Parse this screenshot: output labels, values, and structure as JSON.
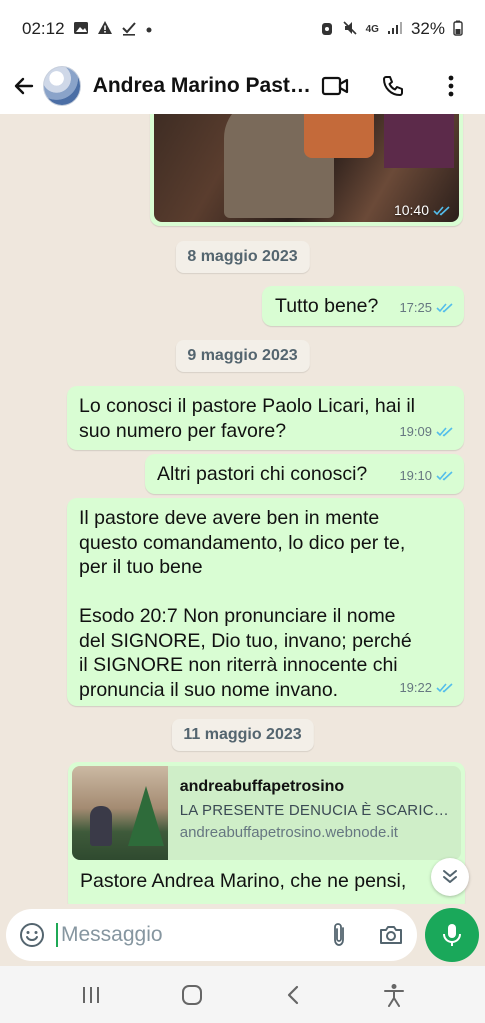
{
  "status_bar": {
    "time": "02:12",
    "battery": "32%",
    "network": "4G"
  },
  "header": {
    "contact_name": "Andrea Marino Pastore..."
  },
  "messages": {
    "photo": {
      "time": "10:40"
    },
    "date1": "8 maggio 2023",
    "m1": {
      "text": "Tutto bene?",
      "time": "17:25"
    },
    "date2": "9 maggio 2023",
    "m2": {
      "line1": "Lo conosci il pastore Paolo Licari, hai il",
      "line2": "suo numero per favore?",
      "time": "19:09"
    },
    "m3": {
      "text": "Altri pastori chi conosci?",
      "time": "19:10"
    },
    "m4": {
      "lines": [
        "Il pastore deve avere ben in mente",
        "questo comandamento, lo dico per te,",
        "per il tuo bene",
        "",
        "Esodo 20:7  Non pronunciare il nome",
        "del SIGNORE, Dio tuo, invano; perché",
        "il SIGNORE non riterrà innocente chi",
        "pronuncia il suo nome invano."
      ],
      "time": "19:22"
    },
    "date3": "11 maggio 2023",
    "link": {
      "title": "andreabuffapetrosino",
      "description": "LA PRESENTE DENUCIA È SCARICAB...",
      "domain": "andreabuffapetrosino.webnode.it",
      "body": "Pastore Andrea Marino, che ne pensi,"
    }
  },
  "input": {
    "placeholder": "Messaggio"
  },
  "colors": {
    "bubble_out": "#d9fdd3",
    "chat_bg": "#efe7dd",
    "accent_green": "#1aa85a",
    "tick_blue": "#53bdeb"
  }
}
